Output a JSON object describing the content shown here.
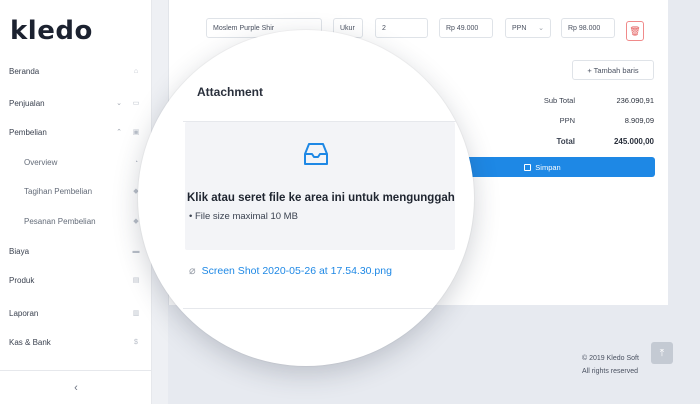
{
  "app": {
    "logo_text": "kledo"
  },
  "sidebar": {
    "items": [
      {
        "label": "Beranda",
        "icon": "home-icon"
      },
      {
        "label": "Penjualan",
        "icon": "cart-icon",
        "chevron": "down"
      },
      {
        "label": "Pembelian",
        "icon": "bag-icon",
        "chevron": "up"
      },
      {
        "label": "Overview",
        "icon": "pie-chart-icon",
        "sub": true
      },
      {
        "label": "Tagihan Pembelian",
        "icon": "tag-icon",
        "sub": true
      },
      {
        "label": "Pesanan Pembelian",
        "icon": "tag-icon",
        "sub": true
      },
      {
        "label": "Biaya",
        "icon": "card-icon"
      },
      {
        "label": "Produk",
        "icon": "box-icon"
      },
      {
        "label": "Laporan",
        "icon": "chart-icon"
      },
      {
        "label": "Kas & Bank",
        "icon": "dollar-icon"
      }
    ],
    "collapse_glyph": "‹"
  },
  "line_item": {
    "product": "Moslem Purple Shir",
    "unit": "Ukur",
    "qty": "2",
    "price": "Rp 49.000",
    "tax": "PPN",
    "amount": "Rp 98.000"
  },
  "add_row_label": "+ Tambah baris",
  "summary": {
    "subtotal_label": "Sub Total",
    "subtotal_value": "236.090,91",
    "ppn_label": "PPN",
    "ppn_value": "8.909,09",
    "total_label": "Total",
    "total_value": "245.000,00"
  },
  "save_label": "Simpan",
  "attachment": {
    "title": "Attachment",
    "drop_text": "Klik atau seret file ke area ini untuk mengunggah",
    "hint": "• File size maximal 10 MB",
    "file_name": "Screen Shot 2020-05-26 at 17.54.30.png"
  },
  "footer": {
    "copyright": "© 2019 Kledo Soft",
    "rights": "All rights reserved"
  },
  "colors": {
    "accent": "#1e88e5",
    "danger": "#e35959"
  }
}
